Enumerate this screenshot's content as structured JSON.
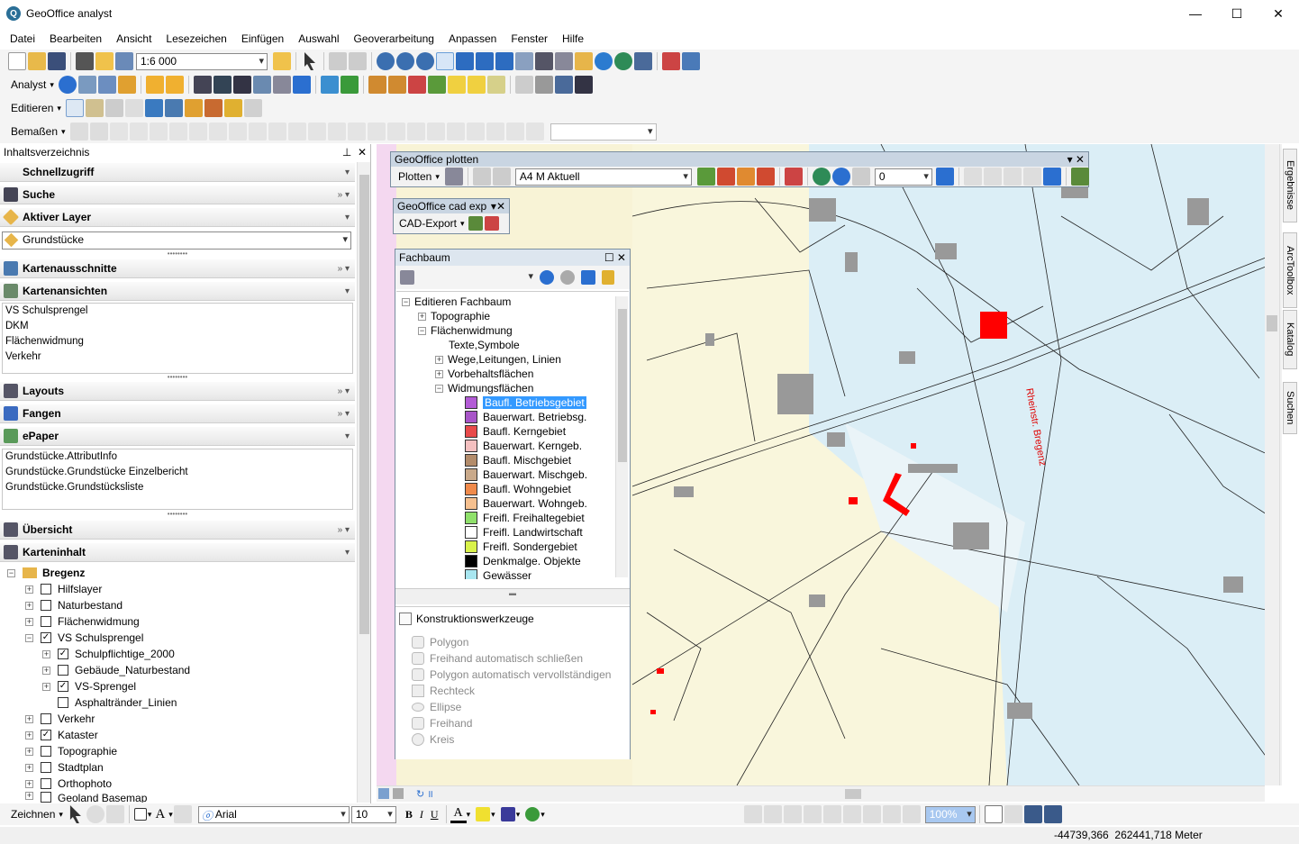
{
  "window": {
    "title": "GeoOffice analyst",
    "minimize": "—",
    "maximize": "☐",
    "close": "✕"
  },
  "menu": [
    "Datei",
    "Bearbeiten",
    "Ansicht",
    "Lesezeichen",
    "Einfügen",
    "Auswahl",
    "Geoverarbeitung",
    "Anpassen",
    "Fenster",
    "Hilfe"
  ],
  "toolbar": {
    "scale": "1:6 000",
    "analyst": "Analyst",
    "editieren": "Editieren",
    "bemassen": "Bemaßen"
  },
  "toc": {
    "title": "Inhaltsverzeichnis",
    "sections": {
      "schnellzugriff": "Schnellzugriff",
      "suche": "Suche",
      "aktiver_layer": "Aktiver Layer",
      "aktiver_layer_value": "Grundstücke",
      "kartenausschnitte": "Kartenausschnitte",
      "kartenansichten": "Kartenansichten",
      "layouts": "Layouts",
      "fangen": "Fangen",
      "epaper": "ePaper",
      "uebersicht": "Übersicht",
      "karteninhalt": "Karteninhalt"
    },
    "kartenansichten": [
      "VS Schulsprengel",
      "DKM",
      "Flächenwidmung",
      "Verkehr"
    ],
    "epaper": [
      "Grundstücke.AttributInfo",
      "Grundstücke.Grundstücke Einzelbericht",
      "Grundstücke.Grundstücksliste"
    ],
    "layers": {
      "root": "Bregenz",
      "hilfslayer": "Hilfslayer",
      "naturbestand": "Naturbestand",
      "flaechenwidmung": "Flächenwidmung",
      "vs_schulsprengel": "VS Schulsprengel",
      "schulpflichtige": "Schulpflichtige_2000",
      "gebaeude": "Gebäude_Naturbestand",
      "vs_sprengel": "VS-Sprengel",
      "asphalt": "Asphalträndеr_Linien",
      "verkehr": "Verkehr",
      "kataster": "Kataster",
      "topographie": "Topographie",
      "stadtplan": "Stadtplan",
      "orthophoto": "Orthophoto",
      "geoland": "Geoland Basemap"
    }
  },
  "plotten": {
    "title": "GeoOffice plotten",
    "menu": "Plotten",
    "format": "A4 M Aktuell",
    "value": "0"
  },
  "cad": {
    "title": "GeoOffice cad exp",
    "menu": "CAD-Export"
  },
  "fachbaum": {
    "title": "Fachbaum",
    "root": "Editieren Fachbaum",
    "topographie": "Topographie",
    "flaechenwidmung": "Flächenwidmung",
    "texte": "Texte,Symbole",
    "wege": "Wege,Leitungen, Linien",
    "vorbehalt": "Vorbehaltsflächen",
    "widmung": "Widmungsflächen",
    "items": [
      {
        "label": "Baufl. Betriebsgebiet",
        "color": "#b35bd6"
      },
      {
        "label": "Bauerwart. Betriebsg.",
        "color": "#a855c8"
      },
      {
        "label": "Baufl. Kerngebiet",
        "color": "#e84a4a"
      },
      {
        "label": "Bauerwart. Kerngeb.",
        "color": "#f4c0c0"
      },
      {
        "label": "Baufl. Mischgebiet",
        "color": "#b38c6b"
      },
      {
        "label": "Bauerwart. Mischgeb.",
        "color": "#c9a98a"
      },
      {
        "label": "Baufl. Wohngebiet",
        "color": "#f08a4b"
      },
      {
        "label": "Bauerwart. Wohngeb.",
        "color": "#f6c08f"
      },
      {
        "label": "Freifl. Freihaltegebiet",
        "color": "#8fe06b"
      },
      {
        "label": "Freifl. Landwirtschaft",
        "color": "#ffffff"
      },
      {
        "label": "Freifl. Sondergebiet",
        "color": "#d9f24a"
      },
      {
        "label": "Denkmalge. Objekte",
        "color": "#000000"
      },
      {
        "label": "Gewässer",
        "color": "#a8e6f0"
      }
    ],
    "konstruktion": "Konstruktionswerkzeuge",
    "tools": [
      "Polygon",
      "Freihand automatisch schließen",
      "Polygon automatisch vervollständigen",
      "Rechteck",
      "Ellipse",
      "Freihand",
      "Kreis"
    ]
  },
  "map": {
    "street_label": "Rheinstr. Bregenz",
    "highlight": "#ff0000"
  },
  "right_tabs": [
    "Ergebnisse",
    "ArcToolbox",
    "Katalog",
    "Suchen"
  ],
  "bottom": {
    "zeichnen": "Zeichnen",
    "font": "Arial",
    "size": "10",
    "zoom": "100%",
    "bold": "B",
    "italic": "I",
    "underline": "U"
  },
  "status": {
    "coords": "-44739,366  262441,718 Meter"
  }
}
